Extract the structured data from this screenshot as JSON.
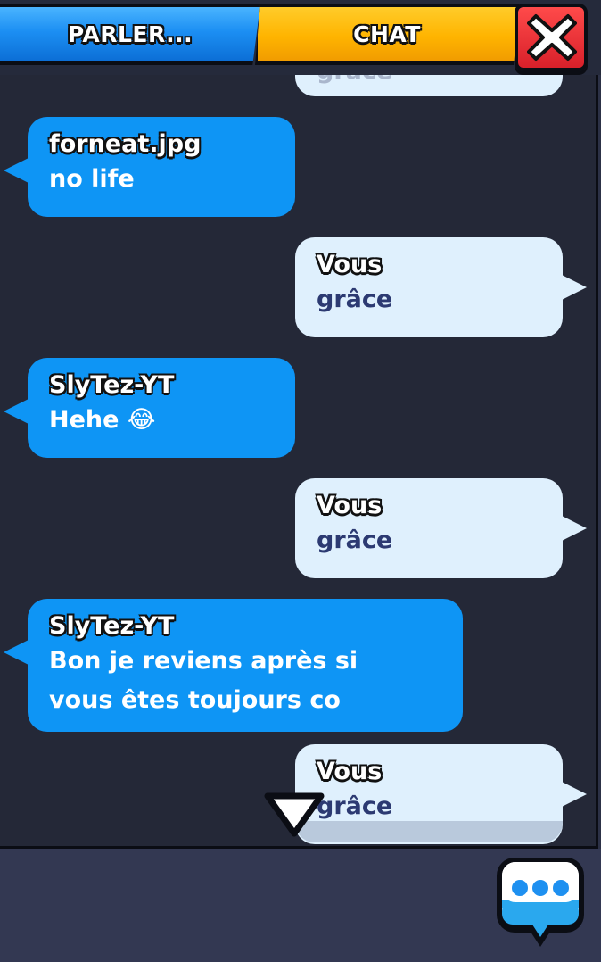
{
  "tabs": {
    "parler": "PARLER...",
    "chat": "CHAT"
  },
  "messages": [
    {
      "from": "them",
      "sender": "forneat.jpg",
      "text": "no life"
    },
    {
      "from": "me",
      "sender": "Vous",
      "text": "grâce"
    },
    {
      "from": "them",
      "sender": "SlyTez-YT",
      "text": "Hehe 😂"
    },
    {
      "from": "me",
      "sender": "Vous",
      "text": "grâce"
    },
    {
      "from": "them",
      "sender": "SlyTez-YT",
      "text_line1": "Bon je reviens après si",
      "text_line2": "vous êtes toujours co"
    },
    {
      "from": "me",
      "sender": "Vous",
      "text": "grâce"
    }
  ],
  "partial_top_text": "grâce",
  "icons": {
    "close": "close-icon",
    "scroll": "scroll-down-arrow-icon",
    "chat": "chat-bubble-icon"
  },
  "colors": {
    "tab_blue": "#1c8ff3",
    "tab_yellow": "#ffb400",
    "close_red": "#e02a30",
    "bubble_them": "#0e95f5",
    "bubble_me": "#dff0fd"
  }
}
